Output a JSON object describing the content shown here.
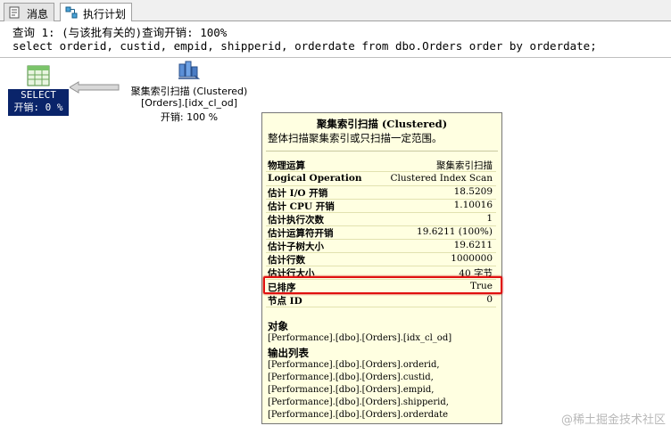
{
  "tabs": [
    {
      "label": "消息"
    },
    {
      "label": "执行计划"
    }
  ],
  "query": {
    "header": "查询 1: (与该批有关的)查询开销: 100%",
    "sql": "select orderid, custid, empid, shipperid, orderdate from dbo.Orders order by orderdate;"
  },
  "select_node": {
    "label": "SELECT",
    "cost": "开销: 0 %"
  },
  "scan_node": {
    "title": "聚集索引扫描 (Clustered)",
    "object": "[Orders].[idx_cl_od]",
    "cost": "开销: 100 %"
  },
  "tooltip": {
    "title": "聚集索引扫描 (Clustered)",
    "description": "整体扫描聚集索引或只扫描一定范围。",
    "rows": [
      {
        "label": "物理运算",
        "value": "聚集索引扫描"
      },
      {
        "label": "Logical Operation",
        "value": "Clustered Index Scan"
      },
      {
        "label": "估计 I/O 开销",
        "value": "18.5209"
      },
      {
        "label": "估计 CPU 开销",
        "value": "1.10016"
      },
      {
        "label": "估计执行次数",
        "value": "1"
      },
      {
        "label": "估计运算符开销",
        "value": "19.6211 (100%)"
      },
      {
        "label": "估计子树大小",
        "value": "19.6211"
      },
      {
        "label": "估计行数",
        "value": "1000000"
      },
      {
        "label": "估计行大小",
        "value": "40 字节"
      },
      {
        "label": "已排序",
        "value": "True"
      },
      {
        "label": "节点 ID",
        "value": "0"
      }
    ],
    "object_header": "对象",
    "object_value": "[Performance].[dbo].[Orders].[idx_cl_od]",
    "output_header": "输出列表",
    "output_list": [
      "[Performance].[dbo].[Orders].orderid,",
      "[Performance].[dbo].[Orders].custid,",
      "[Performance].[dbo].[Orders].empid,",
      "[Performance].[dbo].[Orders].shipperid,",
      "[Performance].[dbo].[Orders].orderdate"
    ]
  },
  "watermark": "@稀土掘金技术社区",
  "colors": {
    "highlight": "#e01010",
    "tooltip_bg": "#ffffe1",
    "select_bg": "#0a246a"
  }
}
